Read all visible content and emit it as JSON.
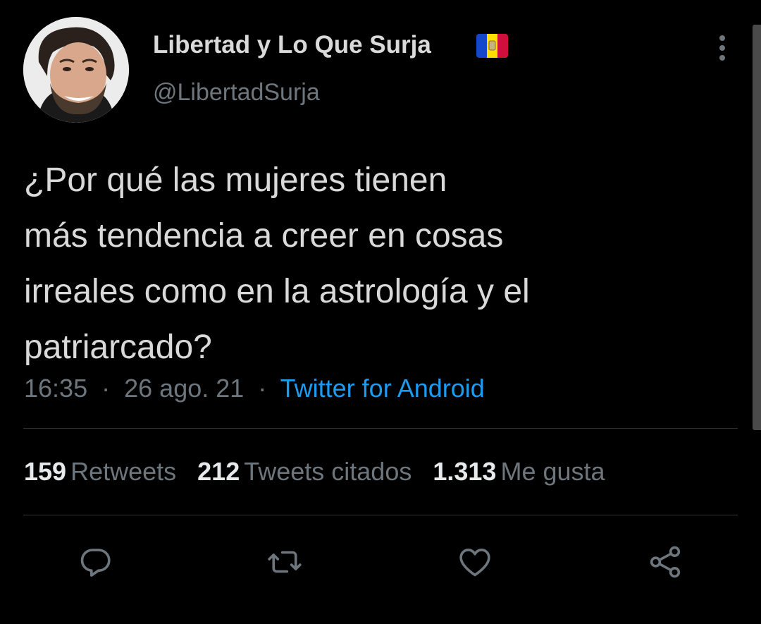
{
  "author": {
    "display_name": "Libertad y Lo Que Surja",
    "handle": "@LibertadSurja",
    "avatar_icon": "profile-photo",
    "badge_icon": "andorra-flag-emoji"
  },
  "tweet": {
    "lines": [
      "¿Por qué las mujeres tienen",
      "más tendencia a creer en cosas",
      "irreales como en la astrología y el",
      "patriarcado?"
    ]
  },
  "meta": {
    "time": "16:35",
    "date": "26 ago. 21",
    "separator": "·",
    "source": "Twitter for Android"
  },
  "stats": {
    "retweets_count": "159",
    "retweets_label": "Retweets",
    "quotes_count": "212",
    "quotes_label": "Tweets citados",
    "likes_count": "1.313",
    "likes_label": "Me gusta"
  },
  "actions": [
    {
      "icon": "reply-icon"
    },
    {
      "icon": "retweet-icon"
    },
    {
      "icon": "like-icon"
    },
    {
      "icon": "share-icon"
    }
  ],
  "colors": {
    "background": "#000000",
    "text": "#d9d9d9",
    "secondary": "#6e767d",
    "link": "#1d9bf0",
    "divider": "#2f3336"
  }
}
